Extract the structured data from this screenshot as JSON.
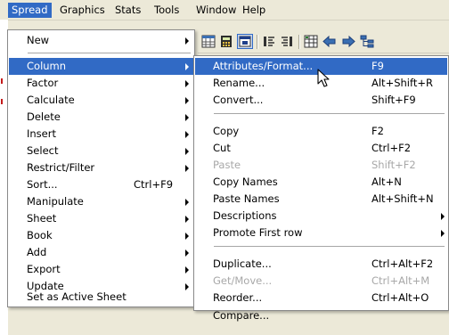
{
  "menubar": {
    "items": [
      "Spread",
      "Graphics",
      "Stats",
      "Tools",
      "Window",
      "Help"
    ],
    "active_index": 0
  },
  "spread_menu": {
    "items": [
      {
        "label": "New",
        "submenu": true
      },
      {
        "label": "Column",
        "submenu": true,
        "selected": true
      },
      {
        "label": "Factor",
        "submenu": true
      },
      {
        "label": "Calculate",
        "submenu": true
      },
      {
        "label": "Delete",
        "submenu": true
      },
      {
        "label": "Insert",
        "submenu": true
      },
      {
        "label": "Select",
        "submenu": true
      },
      {
        "label": "Restrict/Filter",
        "submenu": true
      },
      {
        "label": "Sort...",
        "shortcut": "Ctrl+F9"
      },
      {
        "label": "Manipulate",
        "submenu": true
      },
      {
        "label": "Sheet",
        "submenu": true
      },
      {
        "label": "Book",
        "submenu": true
      },
      {
        "label": "Add",
        "submenu": true
      },
      {
        "label": "Export",
        "submenu": true
      },
      {
        "label": "Update",
        "submenu": true
      },
      {
        "label": "Set as Active Sheet"
      }
    ]
  },
  "column_menu": {
    "items": [
      {
        "label": "Attributes/Format...",
        "shortcut": "F9",
        "selected": true
      },
      {
        "label": "Rename...",
        "shortcut": "Alt+Shift+R"
      },
      {
        "label": "Convert...",
        "shortcut": "Shift+F9"
      },
      {
        "label": "Copy",
        "shortcut": "F2"
      },
      {
        "label": "Cut",
        "shortcut": "Ctrl+F2"
      },
      {
        "label": "Paste",
        "shortcut": "Shift+F2",
        "disabled": true
      },
      {
        "label": "Copy Names",
        "shortcut": "Alt+N"
      },
      {
        "label": "Paste Names",
        "shortcut": "Alt+Shift+N"
      },
      {
        "label": "Descriptions",
        "submenu": true
      },
      {
        "label": "Promote First row",
        "submenu": true
      },
      {
        "label": "Duplicate...",
        "shortcut": "Ctrl+Alt+F2"
      },
      {
        "label": "Get/Move...",
        "shortcut": "Ctrl+Alt+M",
        "disabled": true
      },
      {
        "label": "Reorder...",
        "shortcut": "Ctrl+Alt+O"
      },
      {
        "label": "Compare..."
      }
    ]
  },
  "toolbar": {
    "icons": [
      "spreadsheet-icon",
      "calculator-icon",
      "window-icon",
      "align-left-icon",
      "align-right-icon",
      "sheet-icon",
      "arrow-left-icon",
      "arrow-right-icon",
      "tree-icon"
    ]
  },
  "colors": {
    "selection": "#316ac5",
    "menubar_bg": "#ece9d8",
    "disabled_text": "#a8a8a8"
  }
}
